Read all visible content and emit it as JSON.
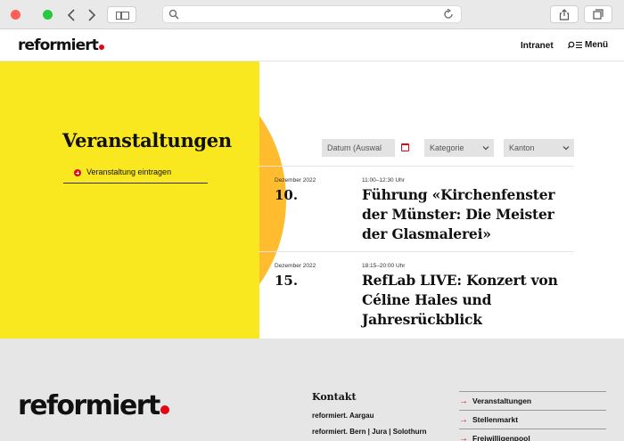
{
  "site": {
    "logo": "reformiert",
    "nav_intranet": "Intranet",
    "nav_menu": "Menü"
  },
  "page": {
    "title": "Veranstaltungen",
    "add_event_label": "Veranstaltung eintragen"
  },
  "filters": {
    "date_placeholder": "Datum (Auswal",
    "category_label": "Kategorie",
    "canton_label": "Kanton"
  },
  "events": [
    {
      "month": "Dezember 2022",
      "day": "10.",
      "time": "11:00–12:30 Uhr",
      "title": "Führung «Kirchenfenster der Münster: Die Meister der Glasmalerei»"
    },
    {
      "month": "Dezember 2022",
      "day": "15.",
      "time": "18:15–20:00 Uhr",
      "title": "RefLab LIVE: Konzert von Céline Hales und Jahresrückblick"
    }
  ],
  "footer": {
    "logo": "reformiert",
    "contact_title": "Kontakt",
    "contact_lines": [
      "reformiert. Aargau",
      "reformiert. Bern | Jura | Solothurn"
    ],
    "links": [
      "Veranstaltungen",
      "Stellenmarkt",
      "Freiwilligenpool"
    ]
  },
  "colors": {
    "accent_yellow": "#f9e71f",
    "accent_red": "#e30613"
  }
}
